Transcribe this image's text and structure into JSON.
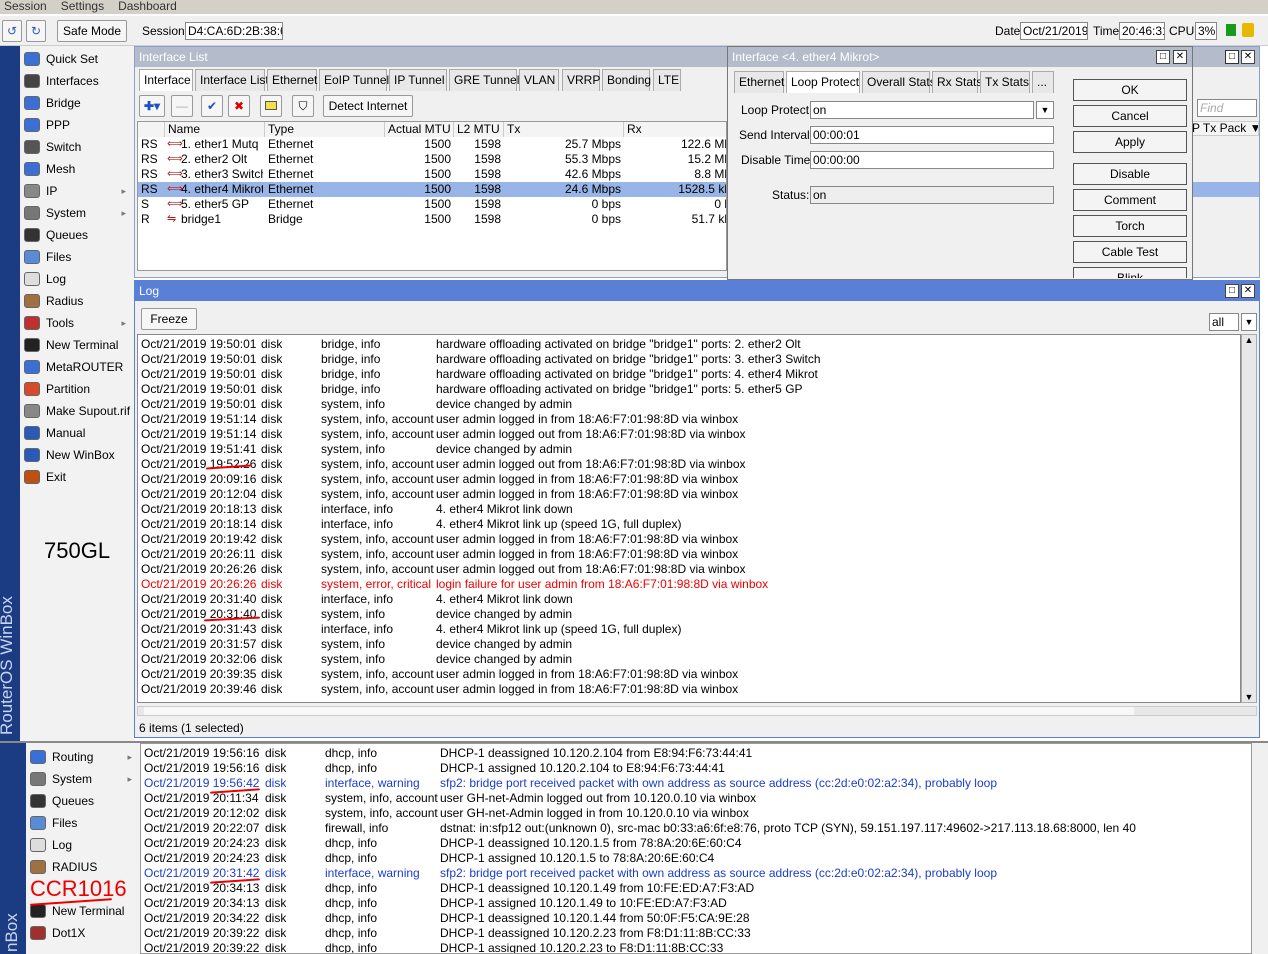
{
  "menu": [
    "Session",
    "Settings",
    "Dashboard"
  ],
  "toolbar": {
    "safe_mode": "Safe Mode",
    "session_label": "Session:",
    "session_value": "D4:CA:6D:2B:38:6B",
    "date_label": "Date:",
    "date_value": "Oct/21/2019",
    "time_label": "Time:",
    "time_value": "20:46:31",
    "cpu_label": "CPU:",
    "cpu_value": "3%"
  },
  "vertical_brand": "RouterOS WinBox",
  "vertical_brand_bottom": "nBox",
  "sidebar": [
    {
      "label": "Quick Set",
      "icon": "quick-set-icon"
    },
    {
      "label": "Interfaces",
      "icon": "interfaces-icon"
    },
    {
      "label": "Bridge",
      "icon": "bridge-icon"
    },
    {
      "label": "PPP",
      "icon": "ppp-icon"
    },
    {
      "label": "Switch",
      "icon": "switch-icon"
    },
    {
      "label": "Mesh",
      "icon": "mesh-icon"
    },
    {
      "label": "IP",
      "icon": "ip-icon",
      "arrow": "▸"
    },
    {
      "label": "System",
      "icon": "system-icon",
      "arrow": "▸"
    },
    {
      "label": "Queues",
      "icon": "queues-icon"
    },
    {
      "label": "Files",
      "icon": "files-icon"
    },
    {
      "label": "Log",
      "icon": "log-icon"
    },
    {
      "label": "Radius",
      "icon": "radius-icon"
    },
    {
      "label": "Tools",
      "icon": "tools-icon",
      "arrow": "▸"
    },
    {
      "label": "New Terminal",
      "icon": "terminal-icon"
    },
    {
      "label": "MetaROUTER",
      "icon": "metarouter-icon"
    },
    {
      "label": "Partition",
      "icon": "partition-icon"
    },
    {
      "label": "Make Supout.rif",
      "icon": "supout-icon"
    },
    {
      "label": "Manual",
      "icon": "manual-icon"
    },
    {
      "label": "New WinBox",
      "icon": "winbox-icon"
    },
    {
      "label": "Exit",
      "icon": "exit-icon"
    }
  ],
  "annotation_top": "750GL",
  "annotation_bottom": "CCR1016",
  "interface_list": {
    "title": "Interface List",
    "tabs": [
      "Interface",
      "Interface List",
      "Ethernet",
      "EoIP Tunnel",
      "IP Tunnel",
      "GRE Tunnel",
      "VLAN",
      "VRRP",
      "Bonding",
      "LTE"
    ],
    "detect_internet": "Detect Internet",
    "find_placeholder": "Find",
    "tx_pack_header": "P Tx Pack",
    "columns": [
      "",
      "Name",
      "Type",
      "Actual MTU",
      "L2 MTU",
      "Tx",
      "Rx"
    ],
    "rows": [
      {
        "flags": "RS",
        "name": "1. ether1   Mutq",
        "type": "Ethernet",
        "mtu": "1500",
        "l2mtu": "1598",
        "tx": "25.7 Mbps",
        "rx": "122.6 Mb"
      },
      {
        "flags": "RS",
        "name": "2. ether2 Olt",
        "type": "Ethernet",
        "mtu": "1500",
        "l2mtu": "1598",
        "tx": "55.3 Mbps",
        "rx": "15.2 Mb"
      },
      {
        "flags": "RS",
        "name": "3. ether3 Switch",
        "type": "Ethernet",
        "mtu": "1500",
        "l2mtu": "1598",
        "tx": "42.6 Mbps",
        "rx": "8.8 Mb"
      },
      {
        "flags": "RS",
        "name": "4. ether4 Mikrot",
        "type": "Ethernet",
        "mtu": "1500",
        "l2mtu": "1598",
        "tx": "24.6 Mbps",
        "rx": "1528.5 kb"
      },
      {
        "flags": "S",
        "name": "5. ether5  GP",
        "type": "Ethernet",
        "mtu": "1500",
        "l2mtu": "1598",
        "tx": "0 bps",
        "rx": "0 b"
      },
      {
        "flags": "R",
        "name": "bridge1",
        "type": "Bridge",
        "mtu": "1500",
        "l2mtu": "1598",
        "tx": "0 bps",
        "rx": "51.7 kb"
      }
    ]
  },
  "iface_dialog": {
    "title": "Interface <4. ether4 Mikrot>",
    "tabs": [
      "Ethernet",
      "Loop Protect",
      "Overall Stats",
      "Rx Stats",
      "Tx Stats",
      "..."
    ],
    "loop_protect_label": "Loop Protect:",
    "loop_protect_value": "on",
    "send_interval_label": "Send Interval:",
    "send_interval_value": "00:00:01",
    "disable_time_label": "Disable Time:",
    "disable_time_value": "00:00:00",
    "status_label": "Status:",
    "status_value": "on",
    "buttons": [
      "OK",
      "Cancel",
      "Apply",
      "Disable",
      "Comment",
      "Torch",
      "Cable Test",
      "Blink"
    ]
  },
  "log": {
    "title": "Log",
    "freeze": "Freeze",
    "filter_value": "all",
    "footer": "6 items (1 selected)",
    "rows": [
      {
        "time": "Oct/21/2019 19:50:01",
        "buf": "disk",
        "topics": "bridge, info",
        "msg": "hardware offloading activated on bridge \"bridge1\" ports: 2. ether2 Olt"
      },
      {
        "time": "Oct/21/2019 19:50:01",
        "buf": "disk",
        "topics": "bridge, info",
        "msg": "hardware offloading activated on bridge \"bridge1\" ports: 3. ether3 Switch"
      },
      {
        "time": "Oct/21/2019 19:50:01",
        "buf": "disk",
        "topics": "bridge, info",
        "msg": "hardware offloading activated on bridge \"bridge1\" ports: 4. ether4 Mikrot"
      },
      {
        "time": "Oct/21/2019 19:50:01",
        "buf": "disk",
        "topics": "bridge, info",
        "msg": "hardware offloading activated on bridge \"bridge1\" ports: 5. ether5  GP"
      },
      {
        "time": "Oct/21/2019 19:50:01",
        "buf": "disk",
        "topics": "system, info",
        "msg": "device changed by admin"
      },
      {
        "time": "Oct/21/2019 19:51:14",
        "buf": "disk",
        "topics": "system, info, account",
        "msg": "user admin logged in from 18:A6:F7:01:98:8D via winbox"
      },
      {
        "time": "Oct/21/2019 19:51:14",
        "buf": "disk",
        "topics": "system, info, account",
        "msg": "user admin logged out from 18:A6:F7:01:98:8D via winbox"
      },
      {
        "time": "Oct/21/2019 19:51:41",
        "buf": "disk",
        "topics": "system, info",
        "msg": "device changed by admin"
      },
      {
        "time": "Oct/21/2019 19:52:26",
        "buf": "disk",
        "topics": "system, info, account",
        "msg": "user admin logged out from 18:A6:F7:01:98:8D via winbox"
      },
      {
        "time": "Oct/21/2019 20:09:16",
        "buf": "disk",
        "topics": "system, info, account",
        "msg": "user admin logged in from 18:A6:F7:01:98:8D via winbox"
      },
      {
        "time": "Oct/21/2019 20:12:04",
        "buf": "disk",
        "topics": "system, info, account",
        "msg": "user admin logged in from 18:A6:F7:01:98:8D via winbox"
      },
      {
        "time": "Oct/21/2019 20:18:13",
        "buf": "disk",
        "topics": "interface, info",
        "msg": "4. ether4 Mikrot link down"
      },
      {
        "time": "Oct/21/2019 20:18:14",
        "buf": "disk",
        "topics": "interface, info",
        "msg": "4. ether4 Mikrot link up (speed 1G, full duplex)"
      },
      {
        "time": "Oct/21/2019 20:19:42",
        "buf": "disk",
        "topics": "system, info, account",
        "msg": "user admin logged in from 18:A6:F7:01:98:8D via winbox"
      },
      {
        "time": "Oct/21/2019 20:26:11",
        "buf": "disk",
        "topics": "system, info, account",
        "msg": "user admin logged in from 18:A6:F7:01:98:8D via winbox"
      },
      {
        "time": "Oct/21/2019 20:26:26",
        "buf": "disk",
        "topics": "system, info, account",
        "msg": "user admin logged out from 18:A6:F7:01:98:8D via winbox"
      },
      {
        "time": "Oct/21/2019 20:26:26",
        "buf": "disk",
        "topics": "system, error, critical",
        "msg": "login failure for user admin from 18:A6:F7:01:98:8D via winbox",
        "color": "red"
      },
      {
        "time": "Oct/21/2019 20:31:40",
        "buf": "disk",
        "topics": "interface, info",
        "msg": "4. ether4 Mikrot link down"
      },
      {
        "time": "Oct/21/2019 20:31:40",
        "buf": "disk",
        "topics": "system, info",
        "msg": "device changed by admin"
      },
      {
        "time": "Oct/21/2019 20:31:43",
        "buf": "disk",
        "topics": "interface, info",
        "msg": "4. ether4 Mikrot link up (speed 1G, full duplex)"
      },
      {
        "time": "Oct/21/2019 20:31:57",
        "buf": "disk",
        "topics": "system, info",
        "msg": "device changed by admin"
      },
      {
        "time": "Oct/21/2019 20:32:06",
        "buf": "disk",
        "topics": "system, info",
        "msg": "device changed by admin"
      },
      {
        "time": "Oct/21/2019 20:39:35",
        "buf": "disk",
        "topics": "system, info, account",
        "msg": "user admin logged in from 18:A6:F7:01:98:8D via winbox"
      },
      {
        "time": "Oct/21/2019 20:39:46",
        "buf": "disk",
        "topics": "system, info, account",
        "msg": "user admin logged in from 18:A6:F7:01:98:8D via winbox"
      }
    ]
  },
  "sidebar2": [
    {
      "label": "Routing",
      "icon": "routing-icon",
      "arrow": "▸"
    },
    {
      "label": "System",
      "icon": "system-icon",
      "arrow": "▸"
    },
    {
      "label": "Queues",
      "icon": "queues-icon"
    },
    {
      "label": "Files",
      "icon": "files-icon"
    },
    {
      "label": "Log",
      "icon": "log-icon"
    },
    {
      "label": "RADIUS",
      "icon": "radius-icon"
    },
    {
      "label": "",
      "icon": ""
    },
    {
      "label": "New Terminal",
      "icon": "terminal-icon"
    },
    {
      "label": "Dot1X",
      "icon": "dot1x-icon"
    }
  ],
  "log2": {
    "rows": [
      {
        "time": "Oct/21/2019 19:56:16",
        "buf": "disk",
        "topics": "dhcp, info",
        "msg": "DHCP-1 deassigned 10.120.2.104 from E8:94:F6:73:44:41"
      },
      {
        "time": "Oct/21/2019 19:56:16",
        "buf": "disk",
        "topics": "dhcp, info",
        "msg": "DHCP-1 assigned 10.120.2.104 to E8:94:F6:73:44:41"
      },
      {
        "time": "Oct/21/2019 19:56:42",
        "buf": "disk",
        "topics": "interface, warning",
        "msg": "sfp2: bridge port received packet with own address as source address (cc:2d:e0:02:a2:34), probably loop",
        "color": "blue"
      },
      {
        "time": "Oct/21/2019 20:11:34",
        "buf": "disk",
        "topics": "system, info, account",
        "msg": "user GH-net-Admin logged out from 10.120.0.10 via winbox"
      },
      {
        "time": "Oct/21/2019 20:12:02",
        "buf": "disk",
        "topics": "system, info, account",
        "msg": "user GH-net-Admin logged in from 10.120.0.10 via winbox"
      },
      {
        "time": "Oct/21/2019 20:22:07",
        "buf": "disk",
        "topics": "firewall, info",
        "msg": "dstnat: in:sfp12 out:(unknown 0), src-mac b0:33:a6:6f:e8:76, proto TCP (SYN), 59.151.197.117:49602->217.113.18.68:8000, len 40"
      },
      {
        "time": "Oct/21/2019 20:24:23",
        "buf": "disk",
        "topics": "dhcp, info",
        "msg": "DHCP-1 deassigned 10.120.1.5 from 78:8A:20:6E:60:C4"
      },
      {
        "time": "Oct/21/2019 20:24:23",
        "buf": "disk",
        "topics": "dhcp, info",
        "msg": "DHCP-1 assigned 10.120.1.5 to 78:8A:20:6E:60:C4"
      },
      {
        "time": "Oct/21/2019 20:31:42",
        "buf": "disk",
        "topics": "interface, warning",
        "msg": "sfp2: bridge port received packet with own address as source address (cc:2d:e0:02:a2:34), probably loop",
        "color": "blue"
      },
      {
        "time": "Oct/21/2019 20:34:13",
        "buf": "disk",
        "topics": "dhcp, info",
        "msg": "DHCP-1 deassigned 10.120.1.49 from 10:FE:ED:A7:F3:AD"
      },
      {
        "time": "Oct/21/2019 20:34:13",
        "buf": "disk",
        "topics": "dhcp, info",
        "msg": "DHCP-1 assigned 10.120.1.49 to 10:FE:ED:A7:F3:AD"
      },
      {
        "time": "Oct/21/2019 20:34:22",
        "buf": "disk",
        "topics": "dhcp, info",
        "msg": "DHCP-1 deassigned 10.120.1.44 from 50:0F:F5:CA:9E:28"
      },
      {
        "time": "Oct/21/2019 20:39:22",
        "buf": "disk",
        "topics": "dhcp, info",
        "msg": "DHCP-1 deassigned 10.120.2.23 from F8:D1:11:8B:CC:33"
      },
      {
        "time": "Oct/21/2019 20:39:22",
        "buf": "disk",
        "topics": "dhcp, info",
        "msg": "DHCP-1 assigned 10.120.2.23 to F8:D1:11:8B:CC:33"
      }
    ]
  }
}
